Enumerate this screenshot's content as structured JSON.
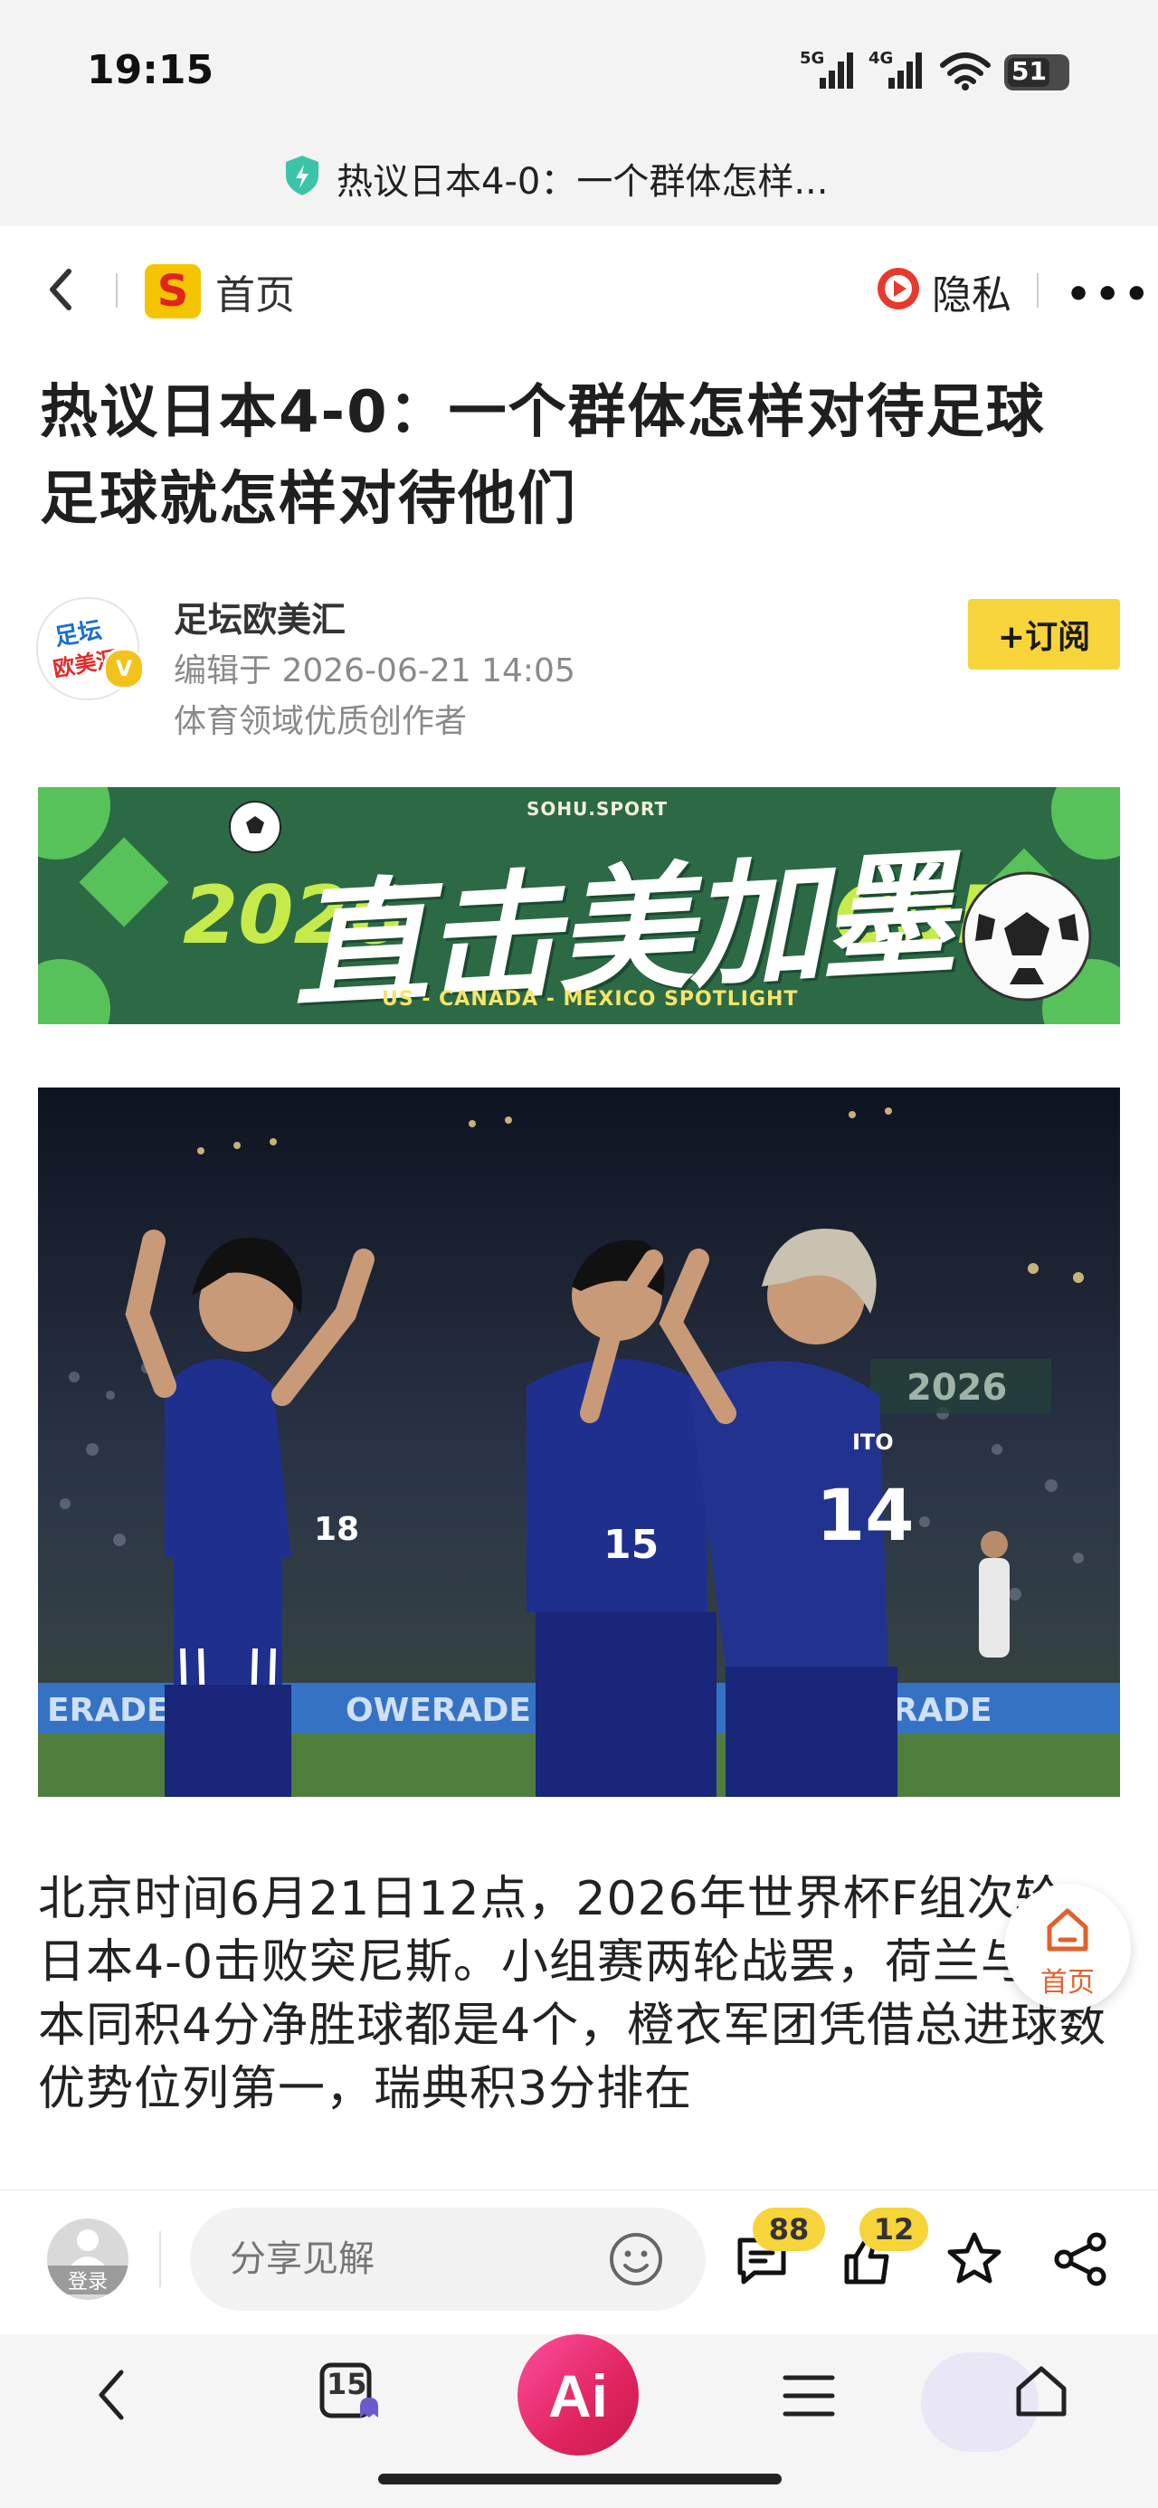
{
  "status_bar": {
    "time": "19:15",
    "signal1": "5G",
    "signal2": "4G",
    "battery": "51"
  },
  "url_bar": {
    "page_title": "热议日本4-0：一个群体怎样..."
  },
  "nav": {
    "home_label": "首页",
    "privacy_label": "隐私",
    "more": "•••"
  },
  "article": {
    "title": "热议日本4-0：一个群体怎样对待足球 足球就怎样对待他们",
    "author": {
      "name": "足坛欧美汇",
      "edited": "编辑于 2026-06-21 14:05",
      "description": "体育领域优质创作者",
      "avatar_line1": "足坛",
      "avatar_line2": "欧美汇",
      "verified_mark": "V"
    },
    "subscribe_label": "+订阅",
    "banner": {
      "small_text": "SOHU.SPORT",
      "year_text": "2026",
      "main_text": "直击美加墨",
      "cup_text": "CUP",
      "footer_text": "US - CANADA - MEXICO  SPOTLIGHT"
    },
    "photo": {
      "scoreboard": "2026",
      "sign_left": "ERADE",
      "sign_mid": "OWERADE",
      "sign_right": "ERADE",
      "player1_number": "18",
      "player2_number": "15",
      "player3_number": "14",
      "player3_name": "ITO"
    },
    "body": "北京时间6月21日12点，2026年世界杯F组次轮，日本4-0击败突尼斯。小组赛两轮战罢，荷兰与日本同积4分净胜球都是4个，橙衣军团凭借总进球数优势位列第一，瑞典积3分排在"
  },
  "floating": {
    "home_label": "首页"
  },
  "action_bar": {
    "login_label": "登录",
    "share_placeholder": "分享见解",
    "comments_count": "88",
    "likes_count": "12"
  },
  "bottom_nav": {
    "tabs_count": "15",
    "ai_label": "Ai"
  },
  "colors": {
    "accent_yellow": "#f7d43a",
    "banner_green": "#2c6a45",
    "ai_pink": "#e0245e",
    "jersey_blue": "#1f2f8e"
  }
}
